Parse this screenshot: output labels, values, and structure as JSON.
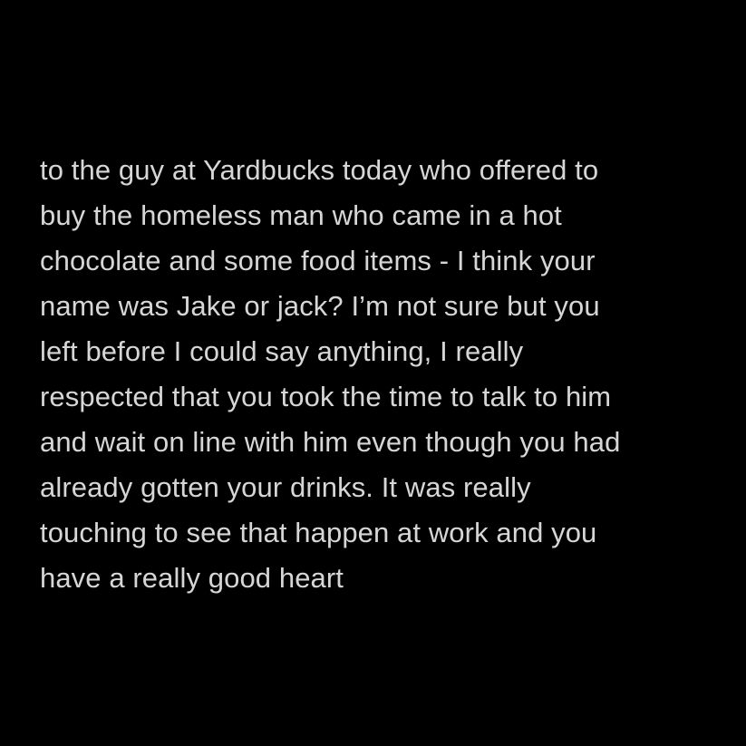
{
  "colors": {
    "background": "#000000",
    "text": "#d6d6d6"
  },
  "message": {
    "lines": [
      "to the guy at Yardbucks today who offered to",
      "buy the homeless man who came in a hot",
      "chocolate and some food items - I think your",
      "name was Jake or jack? I’m not sure but you",
      "left before I could say anything, I really",
      "respected that you took the time to talk to him",
      "and wait on line with him even though you had",
      "already gotten your drinks. It was really",
      "touching to see that happen at work and you",
      "have a really good heart"
    ]
  }
}
